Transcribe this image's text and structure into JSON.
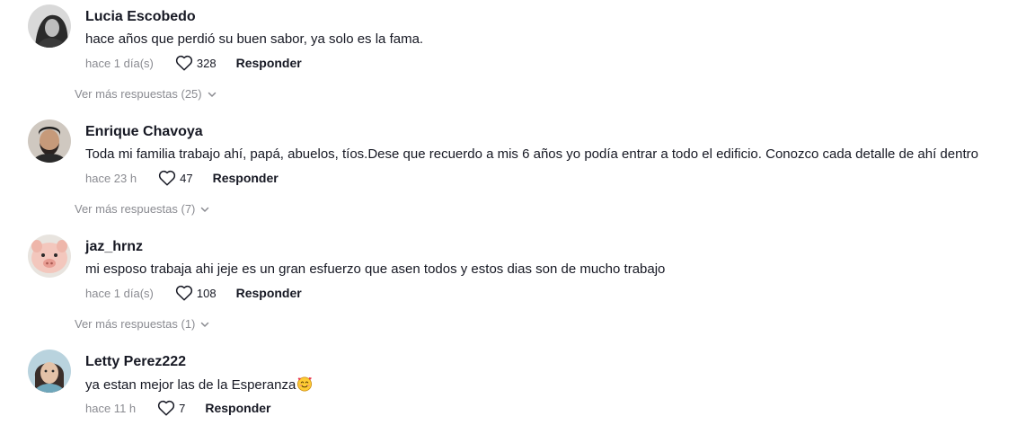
{
  "comments": [
    {
      "user": "Lucia Escobedo",
      "text": "hace años que perdió su buen sabor, ya solo es la fama.",
      "time": "hace 1 día(s)",
      "likes": "328",
      "reply_label": "Responder",
      "more_replies": "Ver más respuestas (25)"
    },
    {
      "user": "Enrique Chavoya",
      "text": "Toda mi familia trabajo ahí, papá, abuelos, tíos.Dese que recuerdo a mis 6 años yo podía entrar a todo el edificio. Conozco cada detalle de ahí dentro",
      "time": "hace 23 h",
      "likes": "47",
      "reply_label": "Responder",
      "more_replies": "Ver más respuestas (7)"
    },
    {
      "user": "jaz_hrnz",
      "text": "mi esposo trabaja ahi jeje es un gran esfuerzo que asen todos y estos dias son de mucho trabajo",
      "time": "hace 1 día(s)",
      "likes": "108",
      "reply_label": "Responder",
      "more_replies": "Ver más respuestas (1)"
    },
    {
      "user": "Letty Perez222",
      "text": "ya estan mejor las de la Esperanza",
      "time": "hace 11 h",
      "likes": "7",
      "reply_label": "Responder"
    }
  ],
  "icons": {
    "like": "heart-outline-icon",
    "expand": "chevron-down-icon",
    "emoji": "smiling-face-with-hearts-emoji"
  },
  "colors": {
    "text": "#161823",
    "muted": "#8a8b91"
  }
}
